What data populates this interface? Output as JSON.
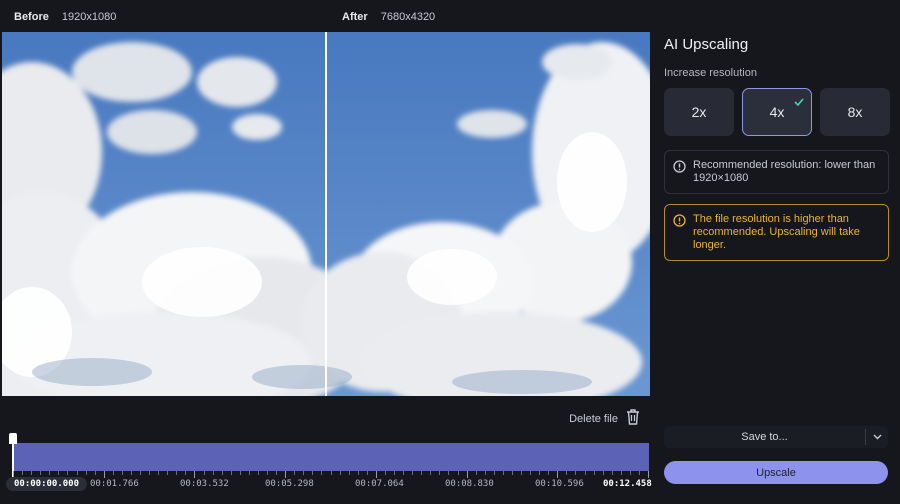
{
  "before": {
    "label": "Before",
    "resolution": "1920x1080"
  },
  "after": {
    "label": "After",
    "resolution": "7680x4320"
  },
  "panel": {
    "title": "AI Upscaling",
    "subtitle": "Increase resolution",
    "scale_options": [
      "2x",
      "4x",
      "8x"
    ],
    "selected_scale": "4x",
    "info_note": "Recommended resolution: lower than 1920×1080",
    "warning_note": "The file resolution is higher than recommended. Upscaling will take longer."
  },
  "delete_file_label": "Delete file",
  "timeline": {
    "labels": [
      "00:00:00.000",
      "00:01.766",
      "00:03.532",
      "00:05.298",
      "00:07.064",
      "00:08.830",
      "00:10.596",
      "00:12.458"
    ]
  },
  "save_to_label": "Save to...",
  "upscale_label": "Upscale",
  "colors": {
    "accent": "#8d93ec",
    "warning": "#e9b338",
    "timeline": "#5c62b6"
  },
  "icons": {
    "delete": "trash-icon",
    "info": "info-icon",
    "warning": "warning-icon",
    "selected": "check-icon",
    "dropdown": "chevron-down-icon"
  }
}
